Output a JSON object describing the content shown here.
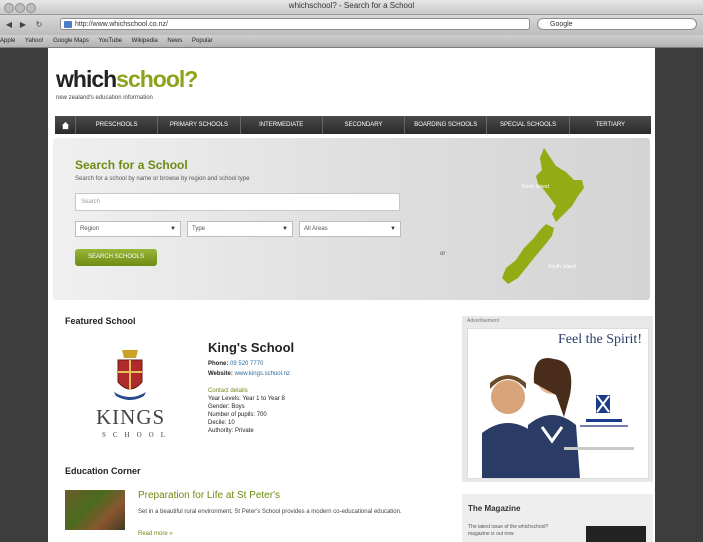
{
  "browser": {
    "window_title": "whichschool? - Search for a School",
    "url": "http://www.whichschool.co.nz/",
    "search_placeholder": "Google",
    "bookmarks": [
      "Apple",
      "Yahoo!",
      "Google Maps",
      "YouTube",
      "Wikipedia",
      "News",
      "Popular"
    ]
  },
  "site": {
    "logo_dark": "which",
    "logo_green": "school?",
    "tagline": "new zealand's education information"
  },
  "nav": {
    "items": [
      "PRESCHOOLS",
      "PRIMARY SCHOOLS",
      "INTERMEDIATE",
      "SECONDARY",
      "BOARDING SCHOOLS",
      "SPECIAL SCHOOLS",
      "TERTIARY"
    ]
  },
  "hero": {
    "title": "Search for a School",
    "subtitle": "Search for a school by name or browse by region and school type",
    "search_placeholder": "Search",
    "selects": [
      "Region",
      "Type",
      "All Areas"
    ],
    "or_label": "or",
    "button_label": "SEARCH SCHOOLS",
    "map_north": "North Island",
    "map_south": "South Island"
  },
  "featured": {
    "heading": "Featured School",
    "logo_word": "KINGS",
    "logo_sub": "SCHOOL",
    "name": "King's School",
    "phone_label": "Phone:",
    "phone": "09 520 7770",
    "website_label": "Website:",
    "website": "www.kings.school.nz",
    "details": [
      "Contact details",
      "Year Levels: Year 1 to Year 8",
      "Gender: Boys",
      "Number of pupils: 700",
      "Decile: 10",
      "Authority: Private"
    ]
  },
  "education": {
    "heading": "Education Corner",
    "article_title": "Preparation for Life at St Peter's",
    "article_text": "Set in a beautiful rural environment, St Peter's School provides a modern co-educational education.",
    "read_more": "Read more »"
  },
  "ad": {
    "label": "Advertisement",
    "headline": "Feel the Spirit!"
  },
  "magazine": {
    "heading": "The Magazine",
    "text": "The latest issue of the whichschool? magazine is out now"
  }
}
